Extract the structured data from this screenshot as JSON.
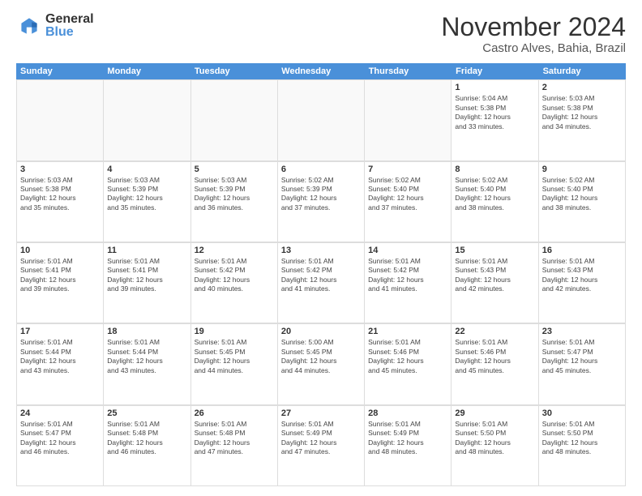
{
  "logo": {
    "general": "General",
    "blue": "Blue"
  },
  "title": "November 2024",
  "location": "Castro Alves, Bahia, Brazil",
  "calendar": {
    "headers": [
      "Sunday",
      "Monday",
      "Tuesday",
      "Wednesday",
      "Thursday",
      "Friday",
      "Saturday"
    ],
    "rows": [
      [
        {
          "day": "",
          "text": "",
          "empty": true
        },
        {
          "day": "",
          "text": "",
          "empty": true
        },
        {
          "day": "",
          "text": "",
          "empty": true
        },
        {
          "day": "",
          "text": "",
          "empty": true
        },
        {
          "day": "",
          "text": "",
          "empty": true
        },
        {
          "day": "1",
          "text": "Sunrise: 5:04 AM\nSunset: 5:38 PM\nDaylight: 12 hours\nand 33 minutes.",
          "empty": false
        },
        {
          "day": "2",
          "text": "Sunrise: 5:03 AM\nSunset: 5:38 PM\nDaylight: 12 hours\nand 34 minutes.",
          "empty": false
        }
      ],
      [
        {
          "day": "3",
          "text": "Sunrise: 5:03 AM\nSunset: 5:38 PM\nDaylight: 12 hours\nand 35 minutes.",
          "empty": false
        },
        {
          "day": "4",
          "text": "Sunrise: 5:03 AM\nSunset: 5:39 PM\nDaylight: 12 hours\nand 35 minutes.",
          "empty": false
        },
        {
          "day": "5",
          "text": "Sunrise: 5:03 AM\nSunset: 5:39 PM\nDaylight: 12 hours\nand 36 minutes.",
          "empty": false
        },
        {
          "day": "6",
          "text": "Sunrise: 5:02 AM\nSunset: 5:39 PM\nDaylight: 12 hours\nand 37 minutes.",
          "empty": false
        },
        {
          "day": "7",
          "text": "Sunrise: 5:02 AM\nSunset: 5:40 PM\nDaylight: 12 hours\nand 37 minutes.",
          "empty": false
        },
        {
          "day": "8",
          "text": "Sunrise: 5:02 AM\nSunset: 5:40 PM\nDaylight: 12 hours\nand 38 minutes.",
          "empty": false
        },
        {
          "day": "9",
          "text": "Sunrise: 5:02 AM\nSunset: 5:40 PM\nDaylight: 12 hours\nand 38 minutes.",
          "empty": false
        }
      ],
      [
        {
          "day": "10",
          "text": "Sunrise: 5:01 AM\nSunset: 5:41 PM\nDaylight: 12 hours\nand 39 minutes.",
          "empty": false
        },
        {
          "day": "11",
          "text": "Sunrise: 5:01 AM\nSunset: 5:41 PM\nDaylight: 12 hours\nand 39 minutes.",
          "empty": false
        },
        {
          "day": "12",
          "text": "Sunrise: 5:01 AM\nSunset: 5:42 PM\nDaylight: 12 hours\nand 40 minutes.",
          "empty": false
        },
        {
          "day": "13",
          "text": "Sunrise: 5:01 AM\nSunset: 5:42 PM\nDaylight: 12 hours\nand 41 minutes.",
          "empty": false
        },
        {
          "day": "14",
          "text": "Sunrise: 5:01 AM\nSunset: 5:42 PM\nDaylight: 12 hours\nand 41 minutes.",
          "empty": false
        },
        {
          "day": "15",
          "text": "Sunrise: 5:01 AM\nSunset: 5:43 PM\nDaylight: 12 hours\nand 42 minutes.",
          "empty": false
        },
        {
          "day": "16",
          "text": "Sunrise: 5:01 AM\nSunset: 5:43 PM\nDaylight: 12 hours\nand 42 minutes.",
          "empty": false
        }
      ],
      [
        {
          "day": "17",
          "text": "Sunrise: 5:01 AM\nSunset: 5:44 PM\nDaylight: 12 hours\nand 43 minutes.",
          "empty": false
        },
        {
          "day": "18",
          "text": "Sunrise: 5:01 AM\nSunset: 5:44 PM\nDaylight: 12 hours\nand 43 minutes.",
          "empty": false
        },
        {
          "day": "19",
          "text": "Sunrise: 5:01 AM\nSunset: 5:45 PM\nDaylight: 12 hours\nand 44 minutes.",
          "empty": false
        },
        {
          "day": "20",
          "text": "Sunrise: 5:00 AM\nSunset: 5:45 PM\nDaylight: 12 hours\nand 44 minutes.",
          "empty": false
        },
        {
          "day": "21",
          "text": "Sunrise: 5:01 AM\nSunset: 5:46 PM\nDaylight: 12 hours\nand 45 minutes.",
          "empty": false
        },
        {
          "day": "22",
          "text": "Sunrise: 5:01 AM\nSunset: 5:46 PM\nDaylight: 12 hours\nand 45 minutes.",
          "empty": false
        },
        {
          "day": "23",
          "text": "Sunrise: 5:01 AM\nSunset: 5:47 PM\nDaylight: 12 hours\nand 45 minutes.",
          "empty": false
        }
      ],
      [
        {
          "day": "24",
          "text": "Sunrise: 5:01 AM\nSunset: 5:47 PM\nDaylight: 12 hours\nand 46 minutes.",
          "empty": false
        },
        {
          "day": "25",
          "text": "Sunrise: 5:01 AM\nSunset: 5:48 PM\nDaylight: 12 hours\nand 46 minutes.",
          "empty": false
        },
        {
          "day": "26",
          "text": "Sunrise: 5:01 AM\nSunset: 5:48 PM\nDaylight: 12 hours\nand 47 minutes.",
          "empty": false
        },
        {
          "day": "27",
          "text": "Sunrise: 5:01 AM\nSunset: 5:49 PM\nDaylight: 12 hours\nand 47 minutes.",
          "empty": false
        },
        {
          "day": "28",
          "text": "Sunrise: 5:01 AM\nSunset: 5:49 PM\nDaylight: 12 hours\nand 48 minutes.",
          "empty": false
        },
        {
          "day": "29",
          "text": "Sunrise: 5:01 AM\nSunset: 5:50 PM\nDaylight: 12 hours\nand 48 minutes.",
          "empty": false
        },
        {
          "day": "30",
          "text": "Sunrise: 5:01 AM\nSunset: 5:50 PM\nDaylight: 12 hours\nand 48 minutes.",
          "empty": false
        }
      ]
    ]
  }
}
